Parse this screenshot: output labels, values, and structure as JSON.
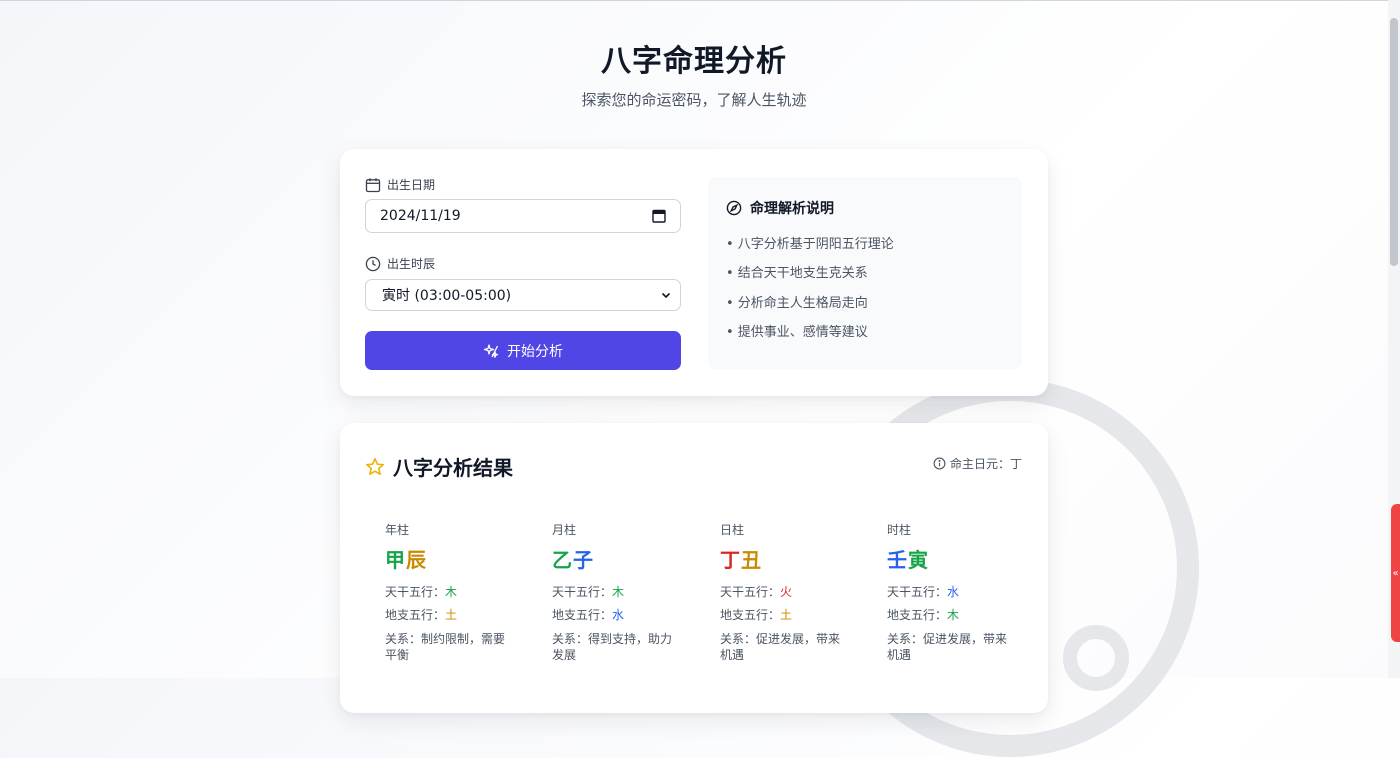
{
  "colors": {
    "wood": "#16a34a",
    "earth": "#ca8a04",
    "water": "#2563eb",
    "fire": "#dc2626",
    "primary": "#4f46e5",
    "star": "#eab308"
  },
  "header": {
    "title": "八字命理分析",
    "subtitle": "探索您的命运密码，了解人生轨迹"
  },
  "form": {
    "date_label": "出生日期",
    "date_value": "2024/11/19",
    "time_label": "出生时辰",
    "time_value": "寅时 (03:00-05:00)",
    "submit_label": "开始分析"
  },
  "info": {
    "title": "命理解析说明",
    "items": [
      "• 八字分析基于阴阳五行理论",
      "• 结合天干地支生克关系",
      "• 分析命主人生格局走向",
      "• 提供事业、感情等建议"
    ]
  },
  "results": {
    "title": "八字分析结果",
    "day_master": "命主日元：丁",
    "stem_prefix": "天干五行：",
    "branch_prefix": "地支五行：",
    "relation_prefix": "关系：",
    "pillars": [
      {
        "label": "年柱",
        "stem": "甲",
        "branch": "辰",
        "stem_element": "木",
        "branch_element": "土",
        "stem_color": "#16a34a",
        "branch_color": "#ca8a04",
        "relation": "制约限制，需要平衡"
      },
      {
        "label": "月柱",
        "stem": "乙",
        "branch": "子",
        "stem_element": "木",
        "branch_element": "水",
        "stem_color": "#16a34a",
        "branch_color": "#2563eb",
        "relation": "得到支持，助力发展"
      },
      {
        "label": "日柱",
        "stem": "丁",
        "branch": "丑",
        "stem_element": "火",
        "branch_element": "土",
        "stem_color": "#dc2626",
        "branch_color": "#ca8a04",
        "relation": "促进发展，带来机遇"
      },
      {
        "label": "时柱",
        "stem": "壬",
        "branch": "寅",
        "stem_element": "水",
        "branch_element": "木",
        "stem_color": "#2563eb",
        "branch_color": "#16a34a",
        "relation": "促进发展，带来机遇"
      }
    ]
  },
  "side_tab": {
    "label": "«"
  }
}
